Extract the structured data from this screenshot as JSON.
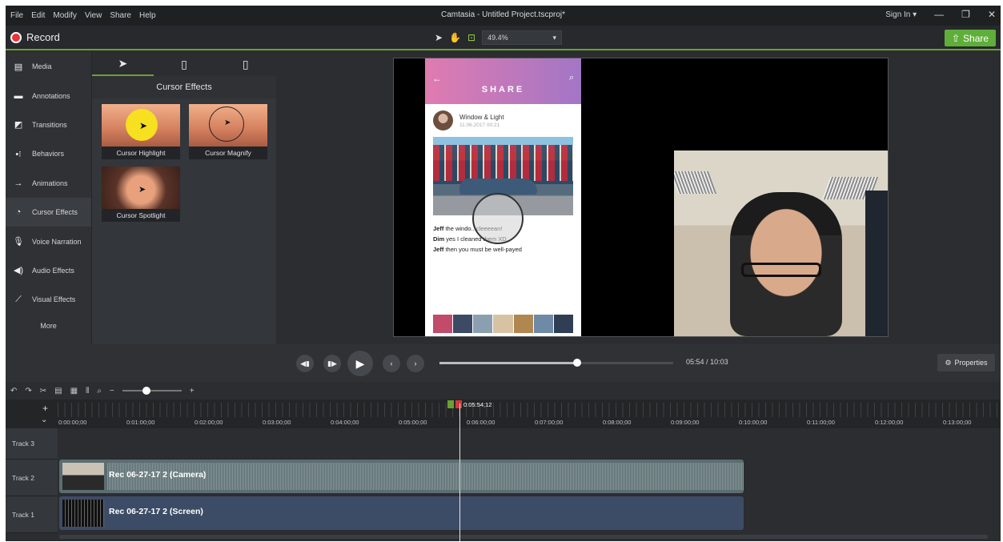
{
  "window": {
    "title": "Camtasia - Untitled Project.tscproj*",
    "sign_in": "Sign In ▾",
    "minimize": "—",
    "maximize": "❐",
    "close": "✕"
  },
  "menu": [
    "File",
    "Edit",
    "Modify",
    "View",
    "Share",
    "Help"
  ],
  "toolbar": {
    "record_label": "Record",
    "zoom_value": "49.4%",
    "share_label": "Share"
  },
  "sidebar": {
    "items": [
      {
        "label": "Media",
        "icon": "film-icon"
      },
      {
        "label": "Annotations",
        "icon": "annotation-icon"
      },
      {
        "label": "Transitions",
        "icon": "transition-icon"
      },
      {
        "label": "Behaviors",
        "icon": "behavior-icon"
      },
      {
        "label": "Animations",
        "icon": "animation-icon"
      },
      {
        "label": "Cursor Effects",
        "icon": "cursor-effects-icon"
      },
      {
        "label": "Voice Narration",
        "icon": "microphone-icon"
      },
      {
        "label": "Audio Effects",
        "icon": "speaker-icon"
      },
      {
        "label": "Visual Effects",
        "icon": "wand-icon"
      }
    ],
    "more_label": "More"
  },
  "effects_panel": {
    "title": "Cursor Effects",
    "items": [
      {
        "label": "Cursor Highlight"
      },
      {
        "label": "Cursor Magnify"
      },
      {
        "label": "Cursor Spotlight"
      }
    ]
  },
  "phone": {
    "header_title": "SHARE",
    "post_name": "Window & Light",
    "post_date": "11.06.2017 00:21",
    "comments": [
      {
        "user": "Jeff",
        "text": "the windo...cleeeean!"
      },
      {
        "user": "Dim",
        "text": "yes I cleaned them XD"
      },
      {
        "user": "Jeff",
        "text": "then you must be well-payed"
      }
    ]
  },
  "playback": {
    "time_current": "05:54",
    "time_total": "10:03",
    "time_separator": "/",
    "properties_label": "Properties",
    "progress": 0.588
  },
  "timeline": {
    "playhead_time": "0:05:54;12",
    "ruler_labels": [
      "0:00:00;00",
      "0:01:00;00",
      "0:02:00;00",
      "0:03:00;00",
      "0:04:00;00",
      "0:05:00;00",
      "0:06:00;00",
      "0:07:00;00",
      "0:08:00;00",
      "0:09:00;00",
      "0:10:00;00",
      "0:11:00;00",
      "0:12:00;00",
      "0:13:00;00"
    ],
    "tracks": [
      {
        "name": "Track 3"
      },
      {
        "name": "Track 2"
      },
      {
        "name": "Track 1"
      }
    ],
    "clips": {
      "camera": "Rec 06-27-17 2 (Camera)",
      "screen": "Rec 06-27-17 2 (Screen)"
    }
  }
}
